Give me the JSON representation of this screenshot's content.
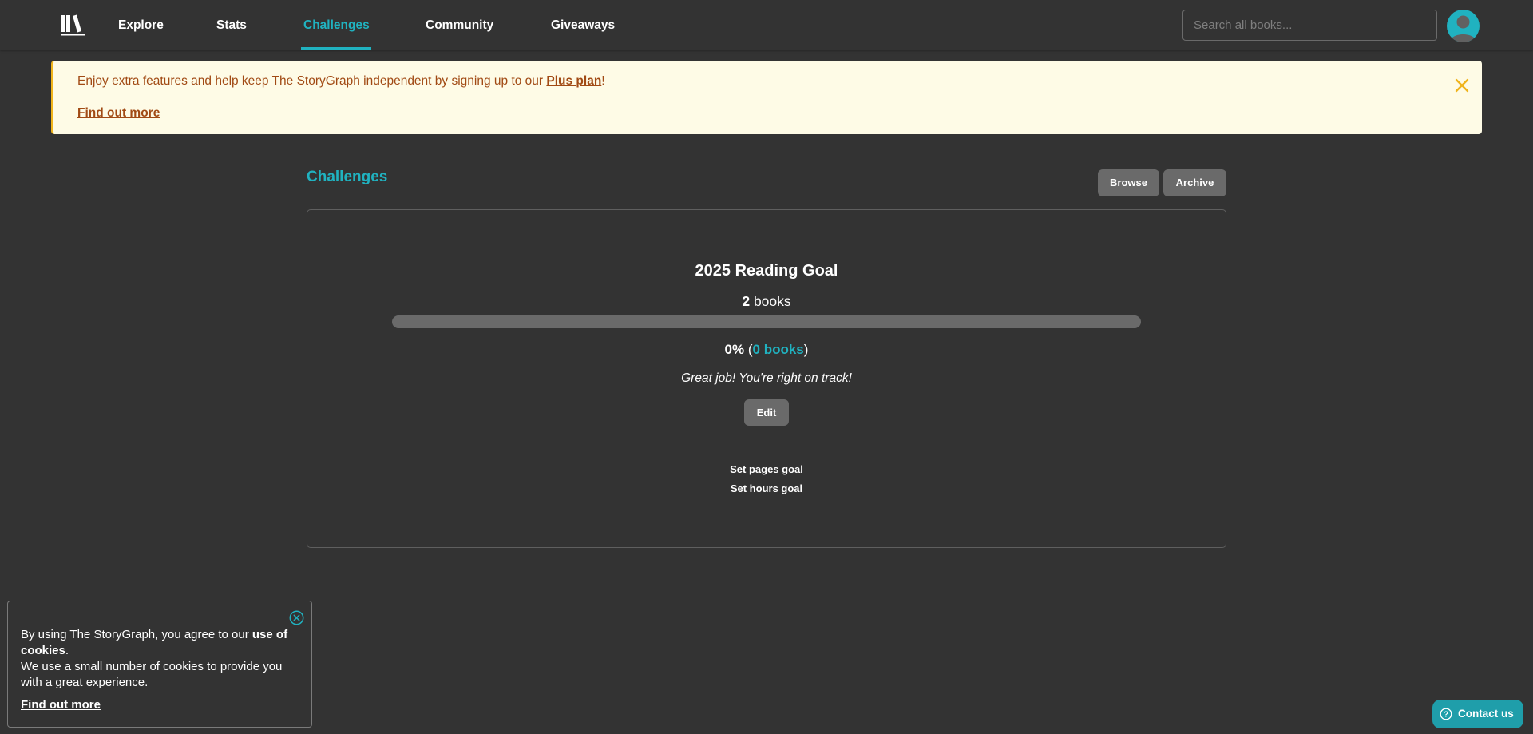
{
  "nav": {
    "items": [
      {
        "label": "Explore"
      },
      {
        "label": "Stats"
      },
      {
        "label": "Challenges"
      },
      {
        "label": "Community"
      },
      {
        "label": "Giveaways"
      }
    ],
    "active_index": 2,
    "search_placeholder": "Search all books..."
  },
  "banner": {
    "text_before": "Enjoy extra features and help keep The StoryGraph independent by signing up to our ",
    "plan_link": "Plus plan",
    "text_after": "!",
    "find_out_more": "Find out more",
    "colors": {
      "background": "#fefbe6",
      "text": "#a14a14",
      "accent": "#f0b41c"
    }
  },
  "page": {
    "title": "Challenges",
    "browse_label": "Browse",
    "archive_label": "Archive"
  },
  "goal": {
    "title": "2025 Reading Goal",
    "target_count": "2",
    "target_unit": " books",
    "progress_fraction": 0,
    "percent_text": "0%",
    "open_paren": " (",
    "books_read_text": "0 books",
    "close_paren": ")",
    "message": "Great job! You're right on track!",
    "edit_label": "Edit",
    "set_pages_goal": "Set pages goal",
    "set_hours_goal": "Set hours goal"
  },
  "cookie": {
    "text_before": "By using The StoryGraph, you agree to our ",
    "bold_link": "use of cookies",
    "period": ".",
    "text_line2": "We use a small number of cookies to provide you with a great experience.",
    "find_out_more": "Find out more"
  },
  "contact": {
    "label": "Contact us"
  },
  "colors": {
    "background": "#333333",
    "accent": "#20b2c0",
    "button": "#6a6a6a",
    "contact_button": "#1f9eaa"
  }
}
